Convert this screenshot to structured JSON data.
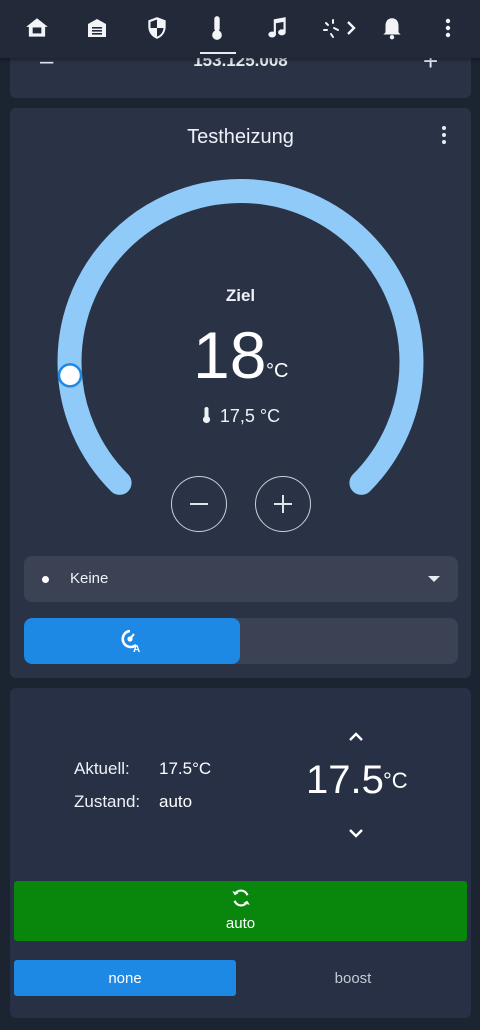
{
  "nav": {
    "icons": [
      "home-icon",
      "garage-icon",
      "shield-icon",
      "thermometer-icon",
      "music-icon",
      "light-icon",
      "chevron-right-icon",
      "bell-icon",
      "more-vert-icon"
    ]
  },
  "partial_card": {
    "value": "153.125.008",
    "minus": "–",
    "plus": "+"
  },
  "thermostat": {
    "title": "Testheizung",
    "target_label": "Ziel",
    "target_value": "18",
    "unit": "°C",
    "current_temp": "17,5 °C",
    "preset_selected": "Keine",
    "setpoint_fraction": 0.15,
    "accent_color": "#90caf9",
    "mode_on_color": "#1e88e5"
  },
  "status_card": {
    "current_label": "Aktuell:",
    "current_value": "17.5°C",
    "state_label": "Zustand:",
    "state_value": "auto",
    "setpoint_value": "17.5",
    "setpoint_unit": "°C",
    "mode_button_label": "auto",
    "mode_button_color": "#09860c",
    "option_none": "none",
    "option_boost": "boost"
  }
}
